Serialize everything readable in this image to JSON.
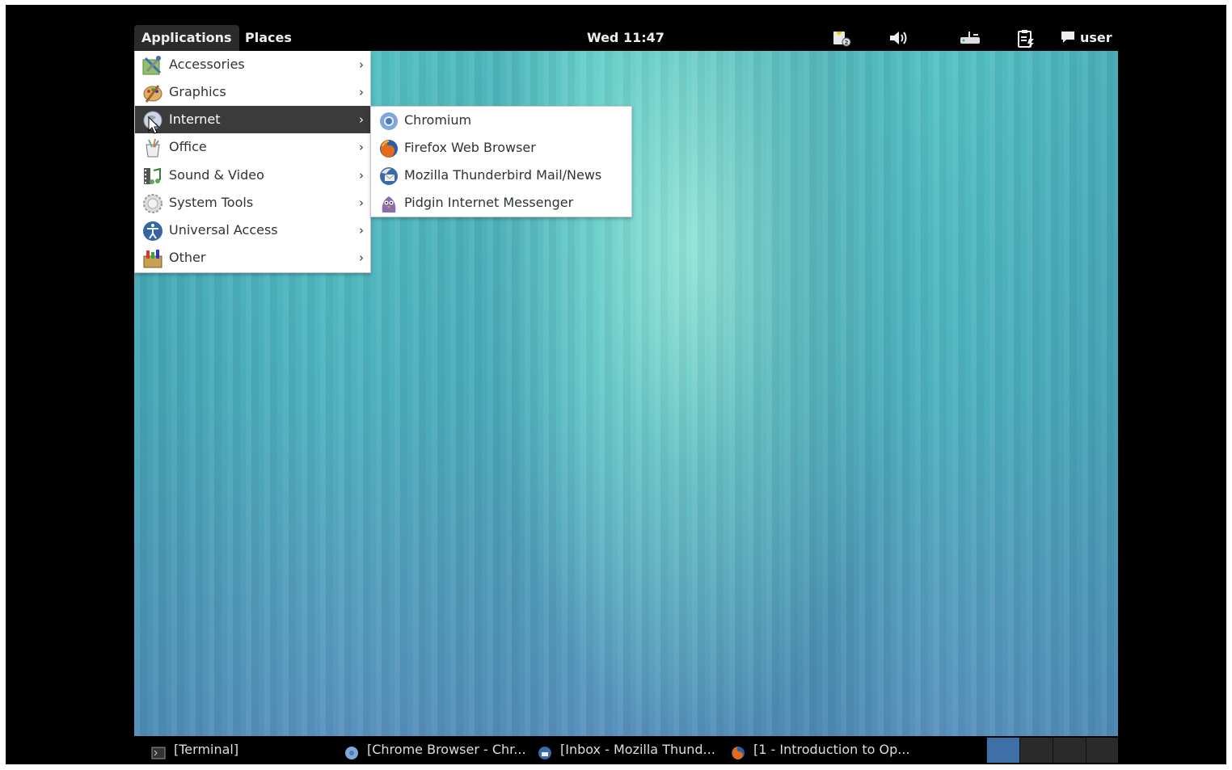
{
  "top_panel": {
    "applications_label": "Applications",
    "places_label": "Places",
    "clock": "Wed 11:47",
    "tray_icons": [
      "notification-icon",
      "volume-icon",
      "network-icon",
      "clipboard-icon"
    ],
    "user_label": "user"
  },
  "app_menu": {
    "items": [
      {
        "label": "Accessories",
        "icon": "accessories-icon"
      },
      {
        "label": "Graphics",
        "icon": "graphics-icon"
      },
      {
        "label": "Internet",
        "icon": "internet-icon",
        "active": true
      },
      {
        "label": "Office",
        "icon": "office-icon"
      },
      {
        "label": "Sound & Video",
        "icon": "sound-video-icon"
      },
      {
        "label": "System Tools",
        "icon": "system-tools-icon"
      },
      {
        "label": "Universal Access",
        "icon": "universal-access-icon"
      },
      {
        "label": "Other",
        "icon": "other-icon"
      }
    ]
  },
  "internet_submenu": {
    "items": [
      {
        "label": "Chromium",
        "icon": "chromium-icon"
      },
      {
        "label": "Firefox Web Browser",
        "icon": "firefox-icon"
      },
      {
        "label": "Mozilla Thunderbird Mail/News",
        "icon": "thunderbird-icon"
      },
      {
        "label": "Pidgin Internet Messenger",
        "icon": "pidgin-icon"
      }
    ]
  },
  "taskbar": {
    "tasks": [
      {
        "label": "[Terminal]",
        "icon": "terminal-icon"
      },
      {
        "label": "[Chrome Browser - Chr...",
        "icon": "chromium-icon"
      },
      {
        "label": "[Inbox - Mozilla Thund...",
        "icon": "thunderbird-icon"
      },
      {
        "label": "[1 - Introduction to Op...",
        "icon": "firefox-icon"
      }
    ],
    "workspaces": 4,
    "active_workspace": 1
  },
  "colors": {
    "panel": "#000000",
    "menu_active": "#3b3b3b",
    "workspace_active": "#3e6fa6",
    "desktop_teal": "#56c3c4"
  }
}
